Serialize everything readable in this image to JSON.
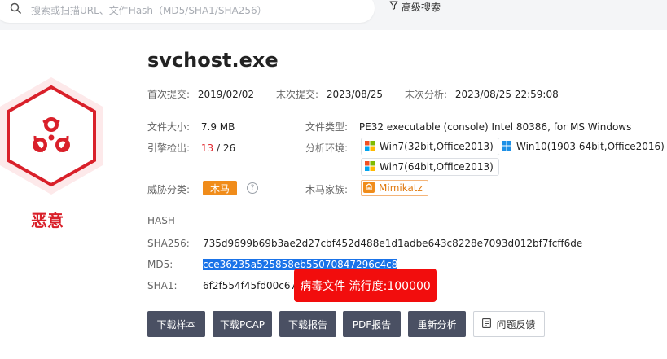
{
  "search": {
    "placeholder": "搜索或扫描URL、文件Hash（MD5/SHA1/SHA256）"
  },
  "advanced_search_label": "高级搜索",
  "verdict": "恶意",
  "file": {
    "name": "svchost.exe",
    "first_submit_label": "首次提交:",
    "first_submit": "2019/02/02",
    "last_submit_label": "末次提交:",
    "last_submit": "2023/08/25",
    "last_analysis_label": "末次分析:",
    "last_analysis": "2023/08/25 22:59:08",
    "size_label": "文件大小:",
    "size": "7.9 MB",
    "type_label": "文件类型:",
    "type": "PE32 executable (console) Intel 80386, for MS Windows",
    "engines_label": "引擎检出:",
    "engines_detected": "13",
    "engines_total": "/ 26",
    "env_label": "分析环境:",
    "environments": [
      "Win7(32bit,Office2013)",
      "Win10(1903 64bit,Office2016)",
      "Win7(64bit,Office2013)"
    ],
    "threat_class_label": "威胁分类:",
    "threat_class": "木马",
    "family_label": "木马家族:",
    "family": "Mimikatz"
  },
  "hash": {
    "section_label": "HASH",
    "sha256_label": "SHA256:",
    "sha256": "735d9699b69b3ae2d27cbf452d488e1d1adbe643c8228e7093d012bf7fcff6de",
    "md5_label": "MD5:",
    "md5": "cce36235a525858eb55070847296c4c8",
    "sha1_label": "SHA1:",
    "sha1": "6f2f554f45fd00c674"
  },
  "tooltip": "病毒文件 流行度:100000",
  "buttons": {
    "download_sample": "下载样本",
    "download_pcap": "下载PCAP",
    "download_report": "下载报告",
    "pdf_report": "PDF报告",
    "reanalyze": "重新分析",
    "feedback": "问题反馈"
  },
  "colors": {
    "malicious": "#d9202a",
    "tooltip": "#f20d0d",
    "button_dark": "#4a5063",
    "trojan_tag": "#f08c1a"
  }
}
